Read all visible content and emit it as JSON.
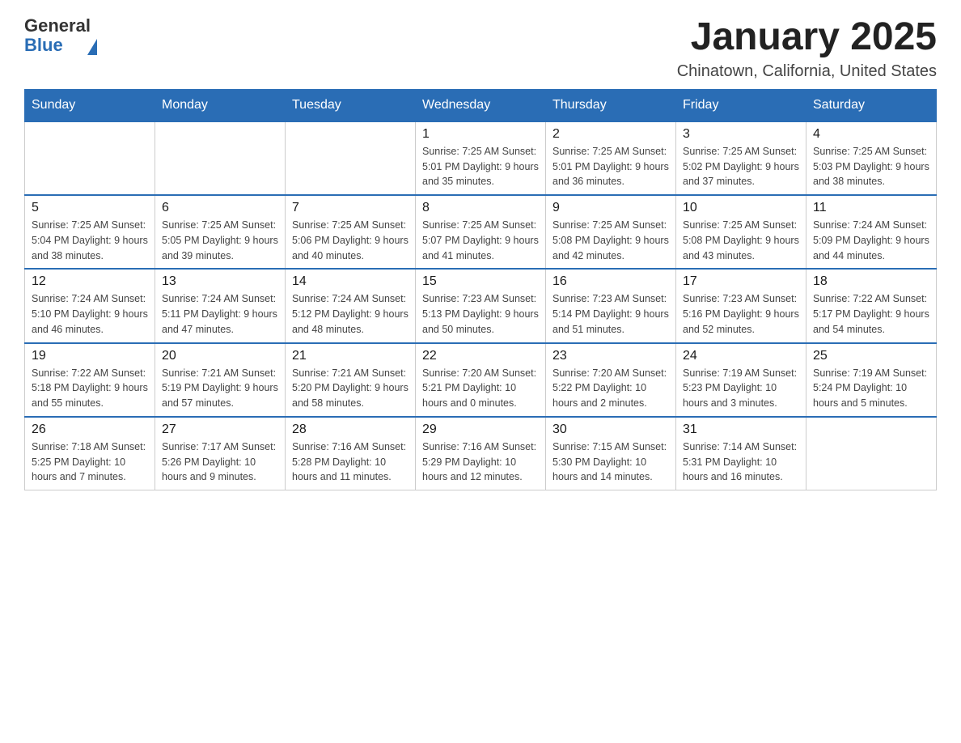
{
  "logo": {
    "general": "General",
    "blue": "Blue"
  },
  "title": "January 2025",
  "location": "Chinatown, California, United States",
  "days_of_week": [
    "Sunday",
    "Monday",
    "Tuesday",
    "Wednesday",
    "Thursday",
    "Friday",
    "Saturday"
  ],
  "weeks": [
    [
      {
        "day": "",
        "info": ""
      },
      {
        "day": "",
        "info": ""
      },
      {
        "day": "",
        "info": ""
      },
      {
        "day": "1",
        "info": "Sunrise: 7:25 AM\nSunset: 5:01 PM\nDaylight: 9 hours and 35 minutes."
      },
      {
        "day": "2",
        "info": "Sunrise: 7:25 AM\nSunset: 5:01 PM\nDaylight: 9 hours and 36 minutes."
      },
      {
        "day": "3",
        "info": "Sunrise: 7:25 AM\nSunset: 5:02 PM\nDaylight: 9 hours and 37 minutes."
      },
      {
        "day": "4",
        "info": "Sunrise: 7:25 AM\nSunset: 5:03 PM\nDaylight: 9 hours and 38 minutes."
      }
    ],
    [
      {
        "day": "5",
        "info": "Sunrise: 7:25 AM\nSunset: 5:04 PM\nDaylight: 9 hours and 38 minutes."
      },
      {
        "day": "6",
        "info": "Sunrise: 7:25 AM\nSunset: 5:05 PM\nDaylight: 9 hours and 39 minutes."
      },
      {
        "day": "7",
        "info": "Sunrise: 7:25 AM\nSunset: 5:06 PM\nDaylight: 9 hours and 40 minutes."
      },
      {
        "day": "8",
        "info": "Sunrise: 7:25 AM\nSunset: 5:07 PM\nDaylight: 9 hours and 41 minutes."
      },
      {
        "day": "9",
        "info": "Sunrise: 7:25 AM\nSunset: 5:08 PM\nDaylight: 9 hours and 42 minutes."
      },
      {
        "day": "10",
        "info": "Sunrise: 7:25 AM\nSunset: 5:08 PM\nDaylight: 9 hours and 43 minutes."
      },
      {
        "day": "11",
        "info": "Sunrise: 7:24 AM\nSunset: 5:09 PM\nDaylight: 9 hours and 44 minutes."
      }
    ],
    [
      {
        "day": "12",
        "info": "Sunrise: 7:24 AM\nSunset: 5:10 PM\nDaylight: 9 hours and 46 minutes."
      },
      {
        "day": "13",
        "info": "Sunrise: 7:24 AM\nSunset: 5:11 PM\nDaylight: 9 hours and 47 minutes."
      },
      {
        "day": "14",
        "info": "Sunrise: 7:24 AM\nSunset: 5:12 PM\nDaylight: 9 hours and 48 minutes."
      },
      {
        "day": "15",
        "info": "Sunrise: 7:23 AM\nSunset: 5:13 PM\nDaylight: 9 hours and 50 minutes."
      },
      {
        "day": "16",
        "info": "Sunrise: 7:23 AM\nSunset: 5:14 PM\nDaylight: 9 hours and 51 minutes."
      },
      {
        "day": "17",
        "info": "Sunrise: 7:23 AM\nSunset: 5:16 PM\nDaylight: 9 hours and 52 minutes."
      },
      {
        "day": "18",
        "info": "Sunrise: 7:22 AM\nSunset: 5:17 PM\nDaylight: 9 hours and 54 minutes."
      }
    ],
    [
      {
        "day": "19",
        "info": "Sunrise: 7:22 AM\nSunset: 5:18 PM\nDaylight: 9 hours and 55 minutes."
      },
      {
        "day": "20",
        "info": "Sunrise: 7:21 AM\nSunset: 5:19 PM\nDaylight: 9 hours and 57 minutes."
      },
      {
        "day": "21",
        "info": "Sunrise: 7:21 AM\nSunset: 5:20 PM\nDaylight: 9 hours and 58 minutes."
      },
      {
        "day": "22",
        "info": "Sunrise: 7:20 AM\nSunset: 5:21 PM\nDaylight: 10 hours and 0 minutes."
      },
      {
        "day": "23",
        "info": "Sunrise: 7:20 AM\nSunset: 5:22 PM\nDaylight: 10 hours and 2 minutes."
      },
      {
        "day": "24",
        "info": "Sunrise: 7:19 AM\nSunset: 5:23 PM\nDaylight: 10 hours and 3 minutes."
      },
      {
        "day": "25",
        "info": "Sunrise: 7:19 AM\nSunset: 5:24 PM\nDaylight: 10 hours and 5 minutes."
      }
    ],
    [
      {
        "day": "26",
        "info": "Sunrise: 7:18 AM\nSunset: 5:25 PM\nDaylight: 10 hours and 7 minutes."
      },
      {
        "day": "27",
        "info": "Sunrise: 7:17 AM\nSunset: 5:26 PM\nDaylight: 10 hours and 9 minutes."
      },
      {
        "day": "28",
        "info": "Sunrise: 7:16 AM\nSunset: 5:28 PM\nDaylight: 10 hours and 11 minutes."
      },
      {
        "day": "29",
        "info": "Sunrise: 7:16 AM\nSunset: 5:29 PM\nDaylight: 10 hours and 12 minutes."
      },
      {
        "day": "30",
        "info": "Sunrise: 7:15 AM\nSunset: 5:30 PM\nDaylight: 10 hours and 14 minutes."
      },
      {
        "day": "31",
        "info": "Sunrise: 7:14 AM\nSunset: 5:31 PM\nDaylight: 10 hours and 16 minutes."
      },
      {
        "day": "",
        "info": ""
      }
    ]
  ]
}
